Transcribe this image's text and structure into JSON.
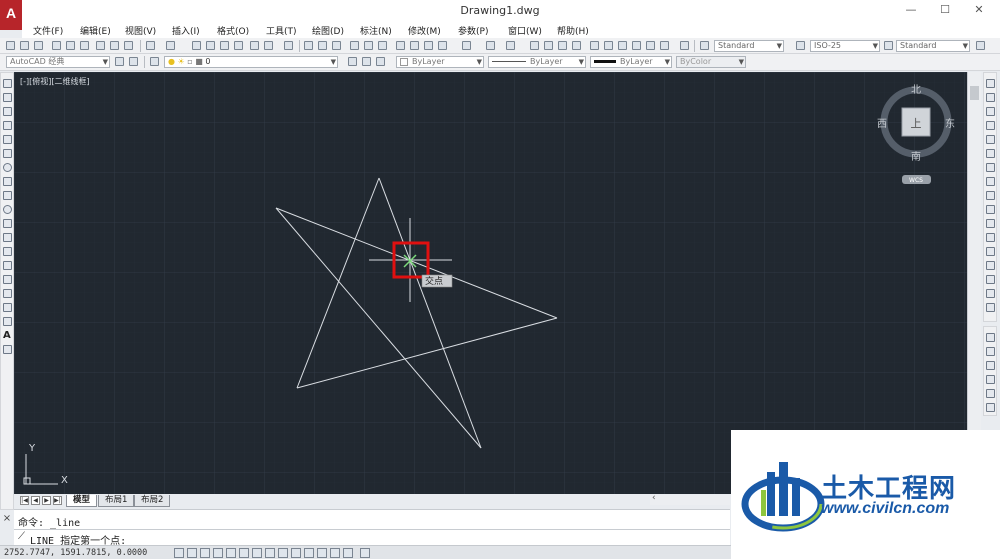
{
  "window": {
    "title": "Drawing1.dwg",
    "app_logo": "A",
    "controls": [
      "—",
      "☐",
      "✕"
    ]
  },
  "menu": {
    "items": [
      "文件(F)",
      "编辑(E)",
      "视图(V)",
      "插入(I)",
      "格式(O)",
      "工具(T)",
      "绘图(D)",
      "标注(N)",
      "修改(M)",
      "参数(P)",
      "窗口(W)",
      "帮助(H)"
    ]
  },
  "toolbar": {
    "text_style": "Standard",
    "dim_style": "ISO-25",
    "table_style": "Standard",
    "workspace": "AutoCAD 经典",
    "layer": "0",
    "color": "ByLayer",
    "linetype": "ByLayer",
    "lineweight": "ByLayer",
    "plotstyle": "ByColor"
  },
  "viewport": {
    "label": "[-][俯视][二维线框]",
    "snap_tooltip": "交点",
    "ucs_y": "Y",
    "ucs_x": "X"
  },
  "viewcube": {
    "north": "北",
    "south": "南",
    "east": "东",
    "west": "西",
    "face": "上",
    "wcs": "WCS"
  },
  "tabs": {
    "model": "模型",
    "layout1": "布局1",
    "layout2": "布局2",
    "nav": [
      "|◀",
      "◀",
      "▶",
      "▶|"
    ]
  },
  "command": {
    "history": "命令: _line",
    "prompt": "LINE 指定第一个点:"
  },
  "status": {
    "coordinates": "2752.7747, 1591.7815, 0.0000"
  },
  "watermark": {
    "brand": "土木工程网",
    "url": "www.civilcn.com"
  },
  "colors": {
    "canvas_bg": "#212830",
    "grid": "#2d3641",
    "star_lines": "#d9dde2",
    "snap_marker": "#e01010",
    "snap_point": "#7cd97c",
    "brand_blue": "#1a5aa8",
    "logo_red": "#b7252a"
  }
}
